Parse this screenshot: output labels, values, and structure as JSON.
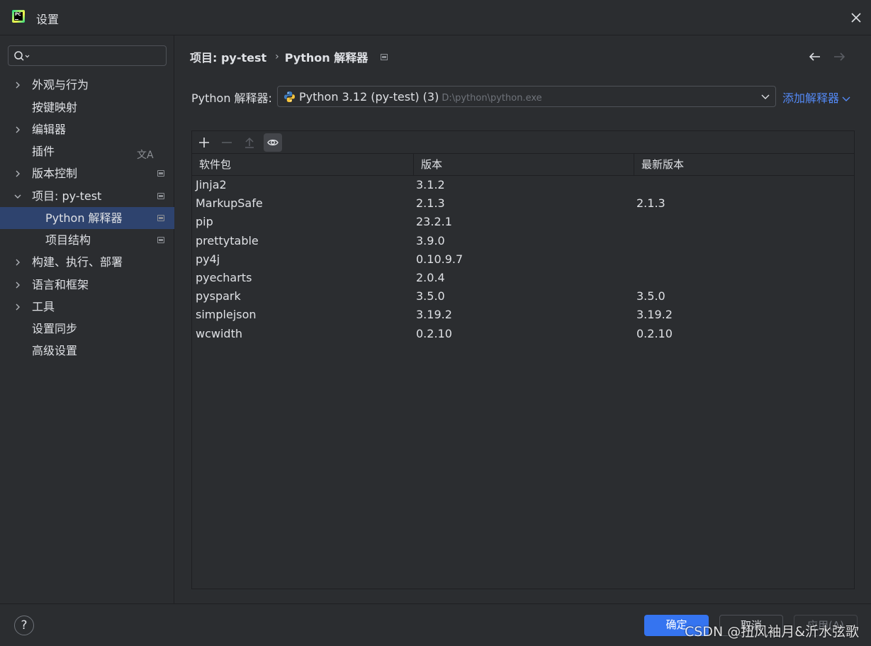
{
  "window": {
    "title": "设置",
    "logo_text": "PC"
  },
  "sidebar": {
    "search": {
      "value": "",
      "placeholder": ""
    },
    "items": [
      {
        "label": "外观与行为"
      },
      {
        "label": "按键映射"
      },
      {
        "label": "编辑器"
      },
      {
        "label": "插件"
      },
      {
        "label": "版本控制"
      },
      {
        "label": "项目: py-test"
      },
      {
        "label": "Python 解释器"
      },
      {
        "label": "项目结构"
      },
      {
        "label": "构建、执行、部署"
      },
      {
        "label": "语言和框架"
      },
      {
        "label": "工具"
      },
      {
        "label": "设置同步"
      },
      {
        "label": "高级设置"
      }
    ]
  },
  "breadcrumb": {
    "project": "项目: py-test",
    "separator": "›",
    "page": "Python 解释器"
  },
  "interpreter": {
    "label": "Python 解释器:",
    "selected_name": "Python 3.12 (py-test) (3)",
    "selected_path": "D:\\python\\python.exe",
    "add_label": "添加解释器"
  },
  "packages": {
    "columns": [
      "软件包",
      "版本",
      "最新版本"
    ],
    "rows": [
      {
        "name": "Jinja2",
        "version": "3.1.2",
        "latest": ""
      },
      {
        "name": "MarkupSafe",
        "version": "2.1.3",
        "latest": "2.1.3"
      },
      {
        "name": "pip",
        "version": "23.2.1",
        "latest": ""
      },
      {
        "name": "prettytable",
        "version": "3.9.0",
        "latest": ""
      },
      {
        "name": "py4j",
        "version": "0.10.9.7",
        "latest": ""
      },
      {
        "name": "pyecharts",
        "version": "2.0.4",
        "latest": ""
      },
      {
        "name": "pyspark",
        "version": "3.5.0",
        "latest": "3.5.0"
      },
      {
        "name": "simplejson",
        "version": "3.19.2",
        "latest": "3.19.2"
      },
      {
        "name": "wcwidth",
        "version": "0.2.10",
        "latest": "0.2.10"
      }
    ]
  },
  "footer": {
    "help_label": "?",
    "ok_label": "确定",
    "cancel_label": "取消",
    "apply_label": "应用(A)"
  },
  "watermark": "CSDN @扭风袖月&沂水弦歌",
  "colors": {
    "background": "#2b2d30",
    "selection": "#2e436e",
    "accent": "#3574f0",
    "link": "#548af7"
  }
}
